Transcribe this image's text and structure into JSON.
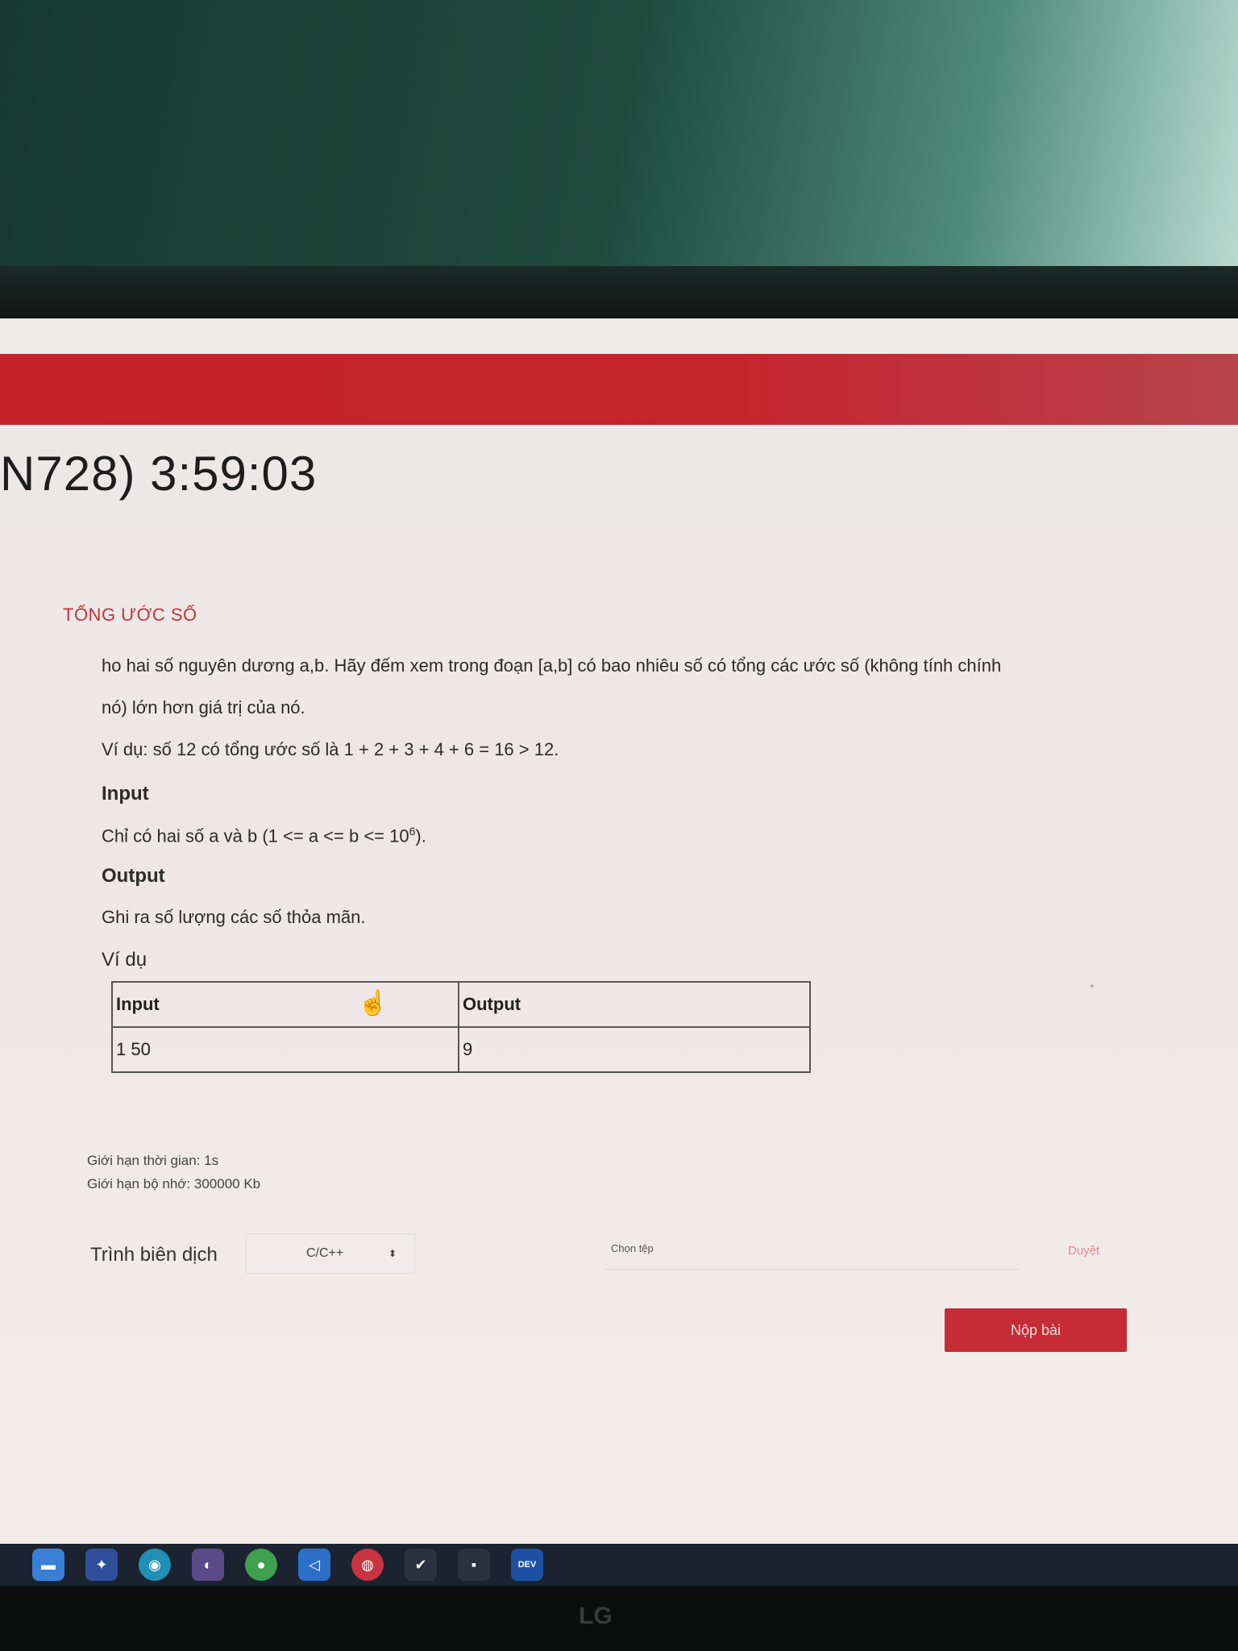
{
  "contest": {
    "title": "N728) 3:59:03"
  },
  "problem": {
    "title": "TỔNG ƯỚC SỐ",
    "statement_line1": "ho hai số nguyên dương a,b. Hãy đếm xem trong đoạn [a,b] có bao nhiêu số có tổng các ước số (không tính chính",
    "statement_line2": "nó) lớn hơn giá trị của nó.",
    "example_line": "Ví dụ: số 12 có tổng ước số là 1 + 2 + 3 + 4 + 6 = 16 > 12.",
    "input_heading": "Input",
    "input_desc_prefix": "Chỉ có hai số a và b (1 <= a <= b <= 10",
    "input_desc_exp": "6",
    "input_desc_suffix": ").",
    "output_heading": "Output",
    "output_desc": "Ghi ra số lượng các số thỏa mãn.",
    "example_heading": "Ví dụ",
    "example_table": {
      "headers": [
        "Input",
        "Output"
      ],
      "rows": [
        [
          "1 50",
          "9"
        ]
      ]
    },
    "time_limit": "Giới hạn thời gian: 1s",
    "memory_limit": "Giới hạn bộ nhớ: 300000 Kb"
  },
  "submit_form": {
    "compiler_label": "Trình biên dịch",
    "compiler_value": "C/C++",
    "file_label": "Chọn tệp",
    "browse_label": "Duyệt",
    "submit_label": "Nộp bài"
  },
  "taskbar": {
    "icons": [
      "file-explorer-icon",
      "app-icon",
      "edge-icon",
      "app-icon-2",
      "chrome-icon",
      "vscode-icon",
      "app-icon-3",
      "app-icon-4",
      "app-icon-5",
      "devcpp-icon"
    ],
    "devcpp_label": "DEV"
  },
  "monitor": {
    "brand": "LG"
  }
}
